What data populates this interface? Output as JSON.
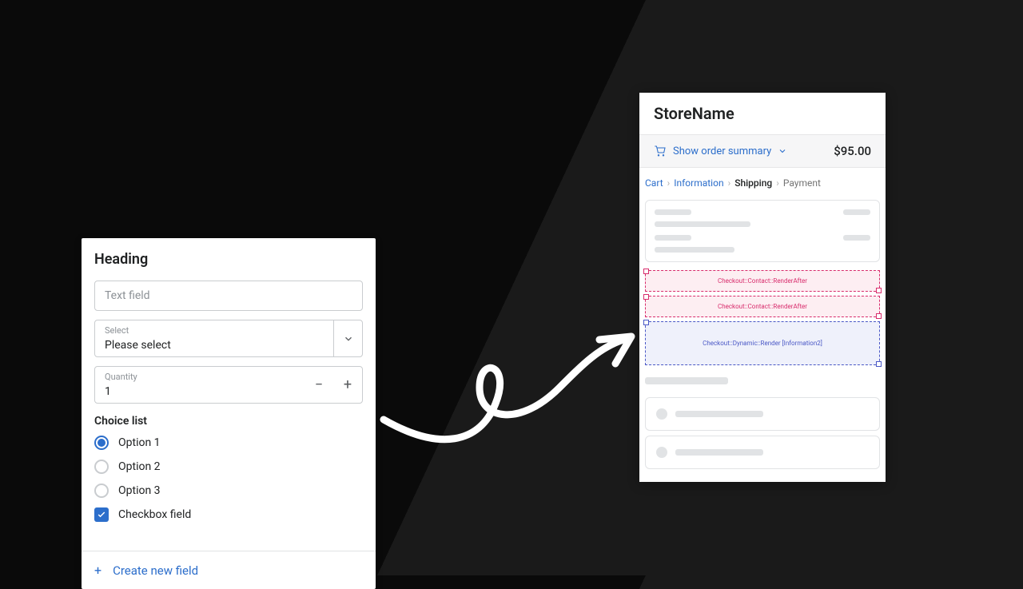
{
  "form": {
    "heading": "Heading",
    "text_field": {
      "placeholder": "Text field"
    },
    "select": {
      "label": "Select",
      "value": "Please select"
    },
    "quantity": {
      "label": "Quantity",
      "value": "1"
    },
    "choice_list_heading": "Choice list",
    "options": [
      {
        "label": "Option 1",
        "selected": true
      },
      {
        "label": "Option 2",
        "selected": false
      },
      {
        "label": "Option 3",
        "selected": false
      }
    ],
    "checkbox": {
      "label": "Checkbox field",
      "checked": true
    },
    "footer_action": "Create new field"
  },
  "checkout": {
    "store_name": "StoreName",
    "summary_toggle": "Show order summary",
    "total": "$95.00",
    "breadcrumbs": {
      "cart": "Cart",
      "information": "Information",
      "shipping": "Shipping",
      "payment": "Payment"
    },
    "zones": {
      "contact_after_1": "Checkout::Contact::RenderAfter",
      "contact_after_2": "Checkout::Contact::RenderAfter",
      "dynamic": "Checkout::Dynamic::Render [Information2]"
    }
  }
}
